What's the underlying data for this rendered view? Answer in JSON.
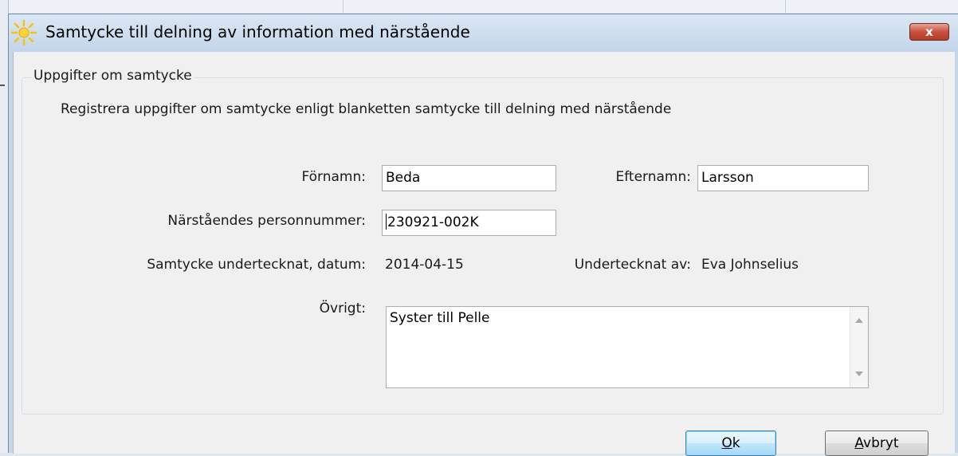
{
  "window": {
    "title": "Samtycke till delning av information med närstående",
    "close_glyph": "x"
  },
  "group": {
    "legend": "Uppgifter om samtycke",
    "instruction": "Registrera uppgifter om samtycke enligt blanketten samtycke till delning med närstående"
  },
  "form": {
    "fornamn_label": "Förnamn:",
    "fornamn_value": "Beda",
    "efternamn_label": "Efternamn:",
    "efternamn_value": "Larsson",
    "personnummer_label": "Närståendes personnummer:",
    "personnummer_value": "230921-002K",
    "datum_label": "Samtycke undertecknat, datum:",
    "datum_value": "2014-04-15",
    "undertecknat_label": "Undertecknat av:",
    "undertecknat_value": "Eva Johnselius",
    "ovrigt_label": "Övrigt:",
    "ovrigt_value": "Syster till Pelle"
  },
  "buttons": {
    "ok_mnemonic": "O",
    "ok_rest": "k",
    "cancel_mnemonic": "A",
    "cancel_rest": "vbryt"
  },
  "icons": {
    "app": "sun-icon",
    "close": "close-icon",
    "scroll_up": "scroll-up-arrow-icon",
    "scroll_down": "scroll-down-arrow-icon"
  },
  "colors": {
    "title_bar": "#c6d6e8",
    "close_button": "#c9503d",
    "client_bg": "#f0f0f0",
    "default_button": "#3c7fb1"
  }
}
